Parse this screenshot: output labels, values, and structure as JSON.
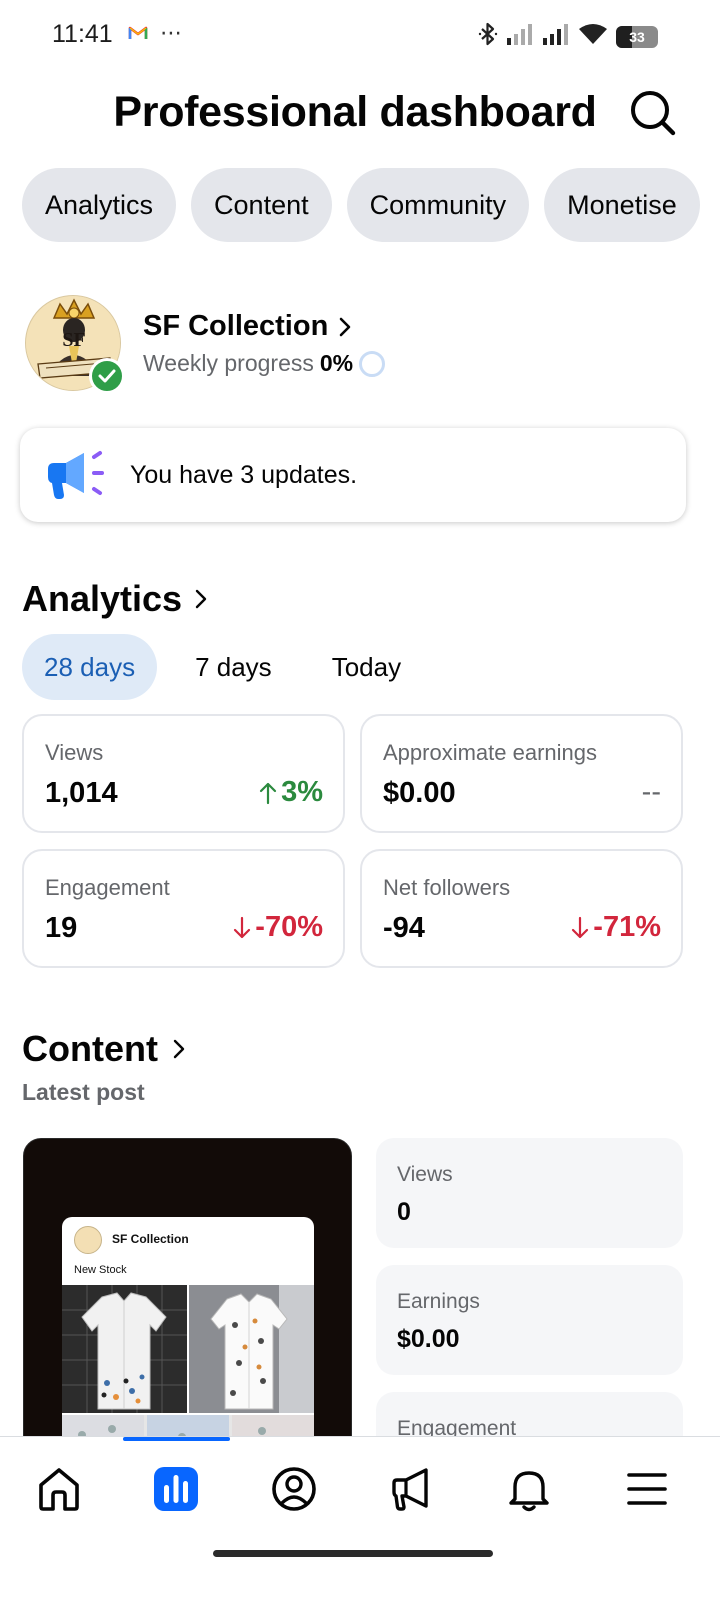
{
  "status_bar": {
    "time": "11:41",
    "overflow": "⋯",
    "battery_level": "33",
    "icons": [
      "gmail-icon",
      "bluetooth-icon",
      "signal-icon",
      "signal-icon",
      "wifi-icon",
      "battery-icon"
    ]
  },
  "header": {
    "title": "Professional dashboard",
    "search_icon": "search-icon"
  },
  "tabs": [
    {
      "label": "Analytics"
    },
    {
      "label": "Content"
    },
    {
      "label": "Community"
    },
    {
      "label": "Monetise"
    }
  ],
  "profile": {
    "name": "SF Collection",
    "weekly_label": "Weekly progress",
    "weekly_value": "0%",
    "weekly_progress": 0,
    "verified": true
  },
  "updates": {
    "text": "You have 3 updates.",
    "icon": "megaphone-icon"
  },
  "analytics": {
    "title": "Analytics",
    "periods": [
      {
        "label": "28 days",
        "active": true
      },
      {
        "label": "7 days",
        "active": false
      },
      {
        "label": "Today",
        "active": false
      }
    ],
    "metrics": [
      {
        "label": "Views",
        "value": "1,014",
        "change": "3%",
        "direction": "up"
      },
      {
        "label": "Approximate earnings",
        "value": "$0.00",
        "change": "--",
        "direction": "neutral"
      },
      {
        "label": "Engagement",
        "value": "19",
        "change": "-70%",
        "direction": "down"
      },
      {
        "label": "Net followers",
        "value": "-94",
        "change": "-71%",
        "direction": "down"
      }
    ]
  },
  "content": {
    "title": "Content",
    "subtitle": "Latest post",
    "post": {
      "author": "SF Collection",
      "caption": "New Stock"
    },
    "stats": [
      {
        "label": "Views",
        "value": "0"
      },
      {
        "label": "Earnings",
        "value": "$0.00"
      },
      {
        "label": "Engagement",
        "value": ""
      }
    ]
  },
  "colors": {
    "accent": "#0866ff",
    "positive": "#2b8a3e",
    "negative": "#d2263c",
    "pill_bg": "#e4e6eb",
    "active_period_bg": "#dfeaf7"
  },
  "bottom_nav": [
    {
      "icon": "home-icon",
      "active": false
    },
    {
      "icon": "dashboard-icon",
      "active": true
    },
    {
      "icon": "profile-icon",
      "active": false
    },
    {
      "icon": "ads-megaphone-icon",
      "active": false
    },
    {
      "icon": "bell-icon",
      "active": false
    },
    {
      "icon": "menu-icon",
      "active": false
    }
  ]
}
